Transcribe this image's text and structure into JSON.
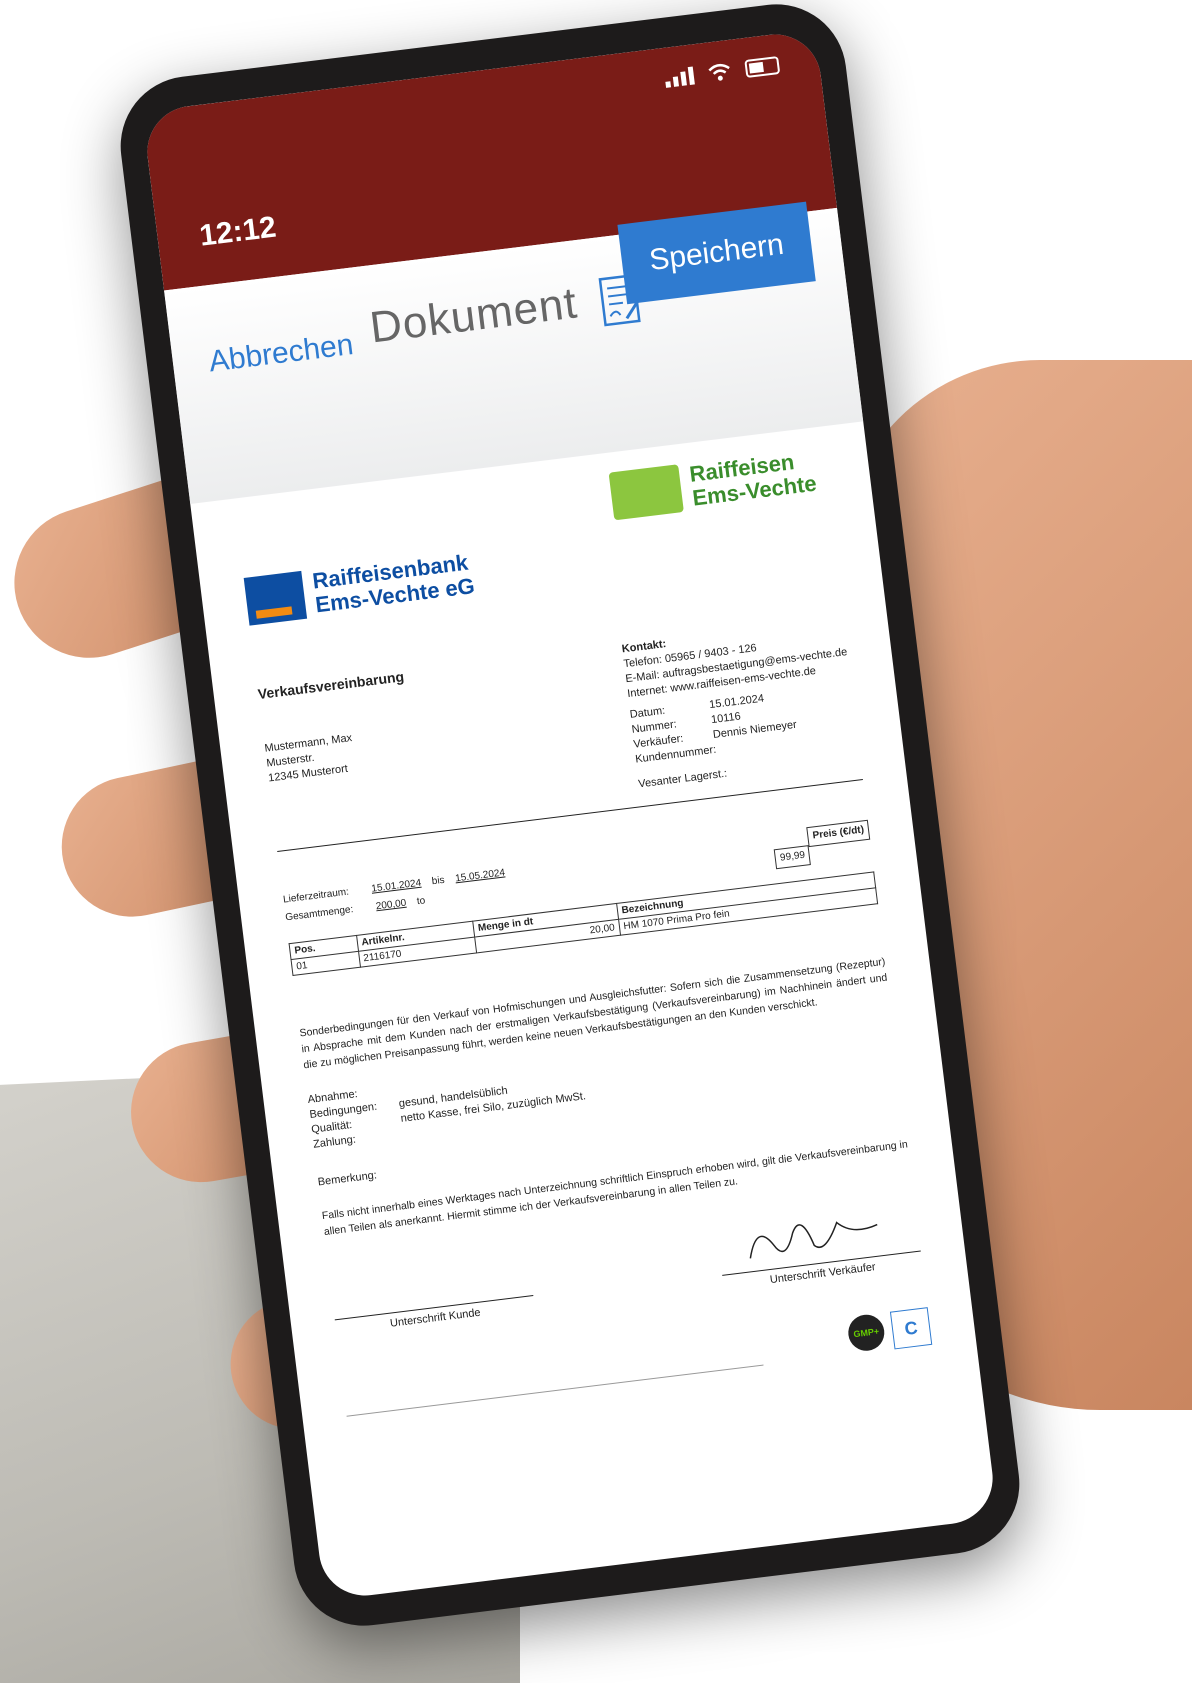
{
  "status_bar": {
    "time": "12:12"
  },
  "navbar": {
    "cancel_label": "Abbrechen",
    "title": "Dokument",
    "save_label": "Speichern"
  },
  "document": {
    "logo_left": {
      "line1": "Raiffeisenbank",
      "line2": "Ems-Vechte eG"
    },
    "logo_right": {
      "line1": "Raiffeisen",
      "line2": "Ems-Vechte"
    },
    "heading": "Verkaufsvereinbarung",
    "address": [
      "Mustermann, Max",
      "Musterstr.",
      "12345 Musterort"
    ],
    "contact": {
      "title": "Kontakt:",
      "phone": "Telefon: 05965 / 9403 - 126",
      "email": "E-Mail: auftragsbestaetigung@ems-vechte.de",
      "web": "Internet: www.raiffeisen-ems-vechte.de",
      "date_label": "Datum:",
      "date_value": "15.01.2024",
      "number_label": "Nummer:",
      "number_value": "10116",
      "seller_label": "Verkäufer:",
      "seller_value": "Dennis Niemeyer",
      "customer_label": "Kundennummer:",
      "agent_label": "Vesanter Lagerst.:"
    },
    "period": {
      "label": "Lieferzeitraum:",
      "from": "15.01.2024",
      "bis": "bis",
      "to": "15.05.2024",
      "qty_label": "Gesamtmenge:",
      "qty_value": "200,00",
      "qty_unit": "to"
    },
    "price_header": "Preis (€/dt)",
    "price_value": "99,99",
    "table": {
      "headers": [
        "Pos.",
        "Artikelnr.",
        "Menge in dt",
        "Bezeichnung"
      ],
      "rows": [
        [
          "01",
          "2116170",
          "20,00",
          "HM 1070 Prima Pro fein"
        ]
      ]
    },
    "paragraph": "Sonderbedingungen für den Verkauf von Hofmischungen und Ausgleichsfutter: Sofern sich die Zusammensetzung (Rezeptur) in Absprache mit dem Kunden nach der erstmaligen Verkaufsbestätigung (Verkaufsvereinbarung) im Nachhinein ändert und die zu möglichen Preisanpassung führt, werden keine neuen Verkaufsbestätigungen an den Kunden verschickt.",
    "conditions": [
      {
        "label": "Abnahme:",
        "value": ""
      },
      {
        "label": "Bedingungen:",
        "value": "gesund, handelsüblich"
      },
      {
        "label": "Qualität:",
        "value": "netto Kasse, frei Silo, zuzüglich MwSt."
      },
      {
        "label": "Zahlung:",
        "value": ""
      }
    ],
    "remark_label": "Bemerkung:",
    "closing": "Falls nicht innerhalb eines Werktages nach Unterzeichnung schriftlich Einspruch erhoben wird, gilt die Verkaufsvereinbarung in allen Teilen als anerkannt. Hiermit stimme ich der Verkaufsvereinbarung in allen Teilen zu.",
    "sign_customer": "Unterschrift Kunde",
    "sign_seller": "Unterschrift Verkäufer",
    "badge_gmp": "GMP+"
  },
  "colors": {
    "status_bar": "#7a1c17",
    "save_button": "#2f7bd0",
    "link": "#2f7bd0",
    "bank_blue": "#0d4ea2",
    "bank_orange": "#f28b12",
    "raiffeisen_green": "#8cc63f"
  },
  "icons": {
    "status": [
      "signal-icon",
      "wifi-icon",
      "battery-icon"
    ],
    "document": "document-sign-icon"
  }
}
